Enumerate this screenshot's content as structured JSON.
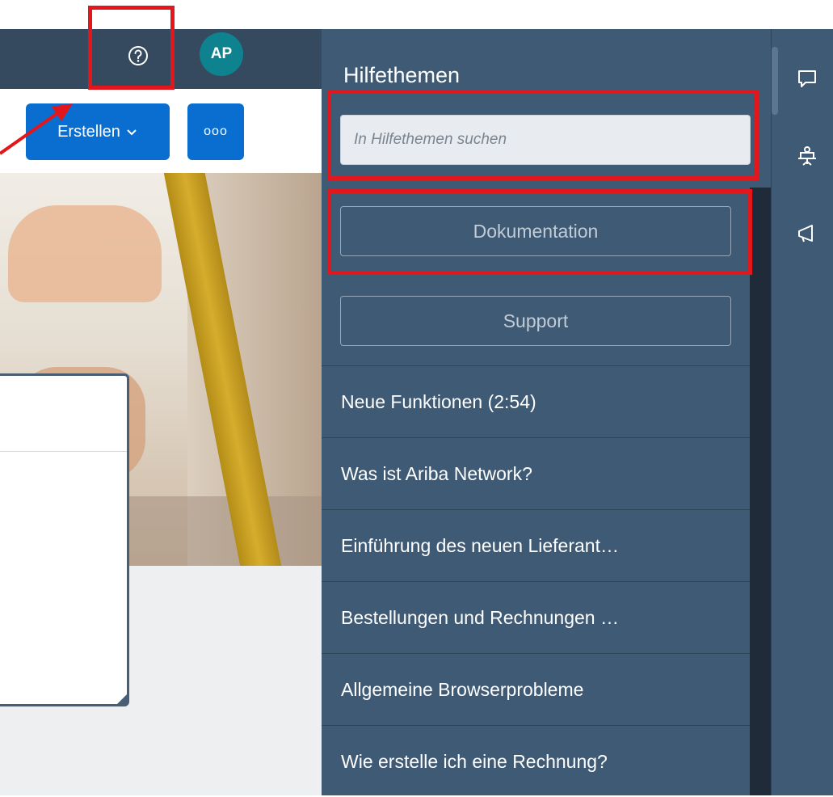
{
  "header": {
    "avatar_initials": "AP"
  },
  "toolbar": {
    "create_label": "Erstellen",
    "more_label": "ooo"
  },
  "help_panel": {
    "title": "Hilfethemen",
    "search_placeholder": "In Hilfethemen suchen",
    "documentation_label": "Dokumentation",
    "support_label": "Support",
    "topics": [
      "Neue Funktionen (2:54)",
      "Was ist Ariba Network?",
      "Einführung des neuen Lieferant…",
      "Bestellungen und Rechnungen …",
      "Allgemeine Browserprobleme",
      "Wie erstelle ich eine Rechnung?"
    ]
  },
  "rail": {
    "icons": [
      "chat-icon",
      "presentation-icon",
      "megaphone-icon"
    ]
  },
  "colors": {
    "shellbar": "#354a5f",
    "panel": "#3f5a75",
    "accent": "#0a6ed1",
    "avatar": "#0f828f",
    "annotation": "#e3161b"
  }
}
